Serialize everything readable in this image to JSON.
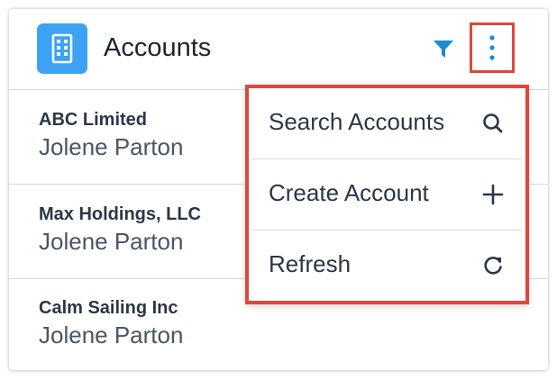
{
  "header": {
    "title": "Accounts",
    "app_icon": "building-icon",
    "filter_icon": "filter-icon",
    "more_icon": "kebab-menu-icon"
  },
  "accounts": [
    {
      "name": "ABC Limited",
      "owner": "Jolene Parton"
    },
    {
      "name": "Max Holdings, LLC",
      "owner": "Jolene Parton"
    },
    {
      "name": "Calm Sailing Inc",
      "owner": "Jolene Parton"
    }
  ],
  "menu": {
    "items": [
      {
        "label": "Search Accounts",
        "icon": "search-icon"
      },
      {
        "label": "Create Account",
        "icon": "plus-icon"
      },
      {
        "label": "Refresh",
        "icon": "refresh-icon"
      }
    ]
  },
  "colors": {
    "accent": "#1b8bd6",
    "app_icon_bg": "#3ea2f3",
    "highlight": "#e0473b",
    "text_dark": "#1c2430",
    "divider": "#d4d8de"
  }
}
